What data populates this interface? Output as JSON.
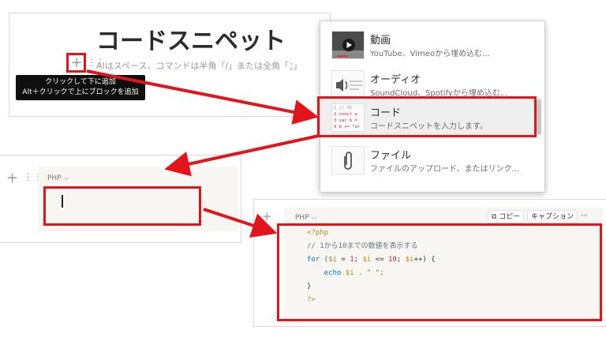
{
  "step1": {
    "title": "コードスニペット",
    "plus_symbol": "+",
    "hint": "AIはスペース、コマンドは半角「/」または全角「；」",
    "tooltip_line1": "クリックして下に追加",
    "tooltip_line2": "Alt＋クリックで上にブロックを追加"
  },
  "menu": {
    "items": [
      {
        "title": "動画",
        "desc": "YouTube、Vimeoから埋め込む...",
        "icon": "video-icon"
      },
      {
        "title": "オーディオ",
        "desc": "SoundCloud、Spotifyから埋め込む...",
        "icon": "audio-icon"
      },
      {
        "title": "コード",
        "desc": "コードスニペットを入力します。",
        "icon": "code-icon"
      },
      {
        "title": "ファイル",
        "desc": "ファイルのアップロード、またはリンク...",
        "icon": "paperclip-icon"
      }
    ],
    "code_thumb_lines": [
      "1 // Th",
      "2 const a",
      "3 var b =",
      "4 b += \"or"
    ]
  },
  "step2": {
    "language": "PHP ⌵"
  },
  "step3": {
    "language": "PHP ⌵",
    "copy_label": "コピー",
    "caption_label": "キャプション",
    "more_label": "···",
    "code": {
      "l1": "<?php",
      "l2": "// 1から10までの数値を表示する",
      "l3a": "for (",
      "l3b": "$i",
      "l3c": " = ",
      "l3d": "1",
      "l3e": "; ",
      "l3f": "$i",
      "l3g": " <= ",
      "l3h": "10",
      "l3i": "; ",
      "l3j": "$i",
      "l3k": "++) {",
      "l4a": "    echo ",
      "l4b": "$i",
      "l4c": " . \" \";",
      "l5": "}",
      "l6": "?>"
    }
  },
  "colors": {
    "highlight": "#e3141c"
  }
}
